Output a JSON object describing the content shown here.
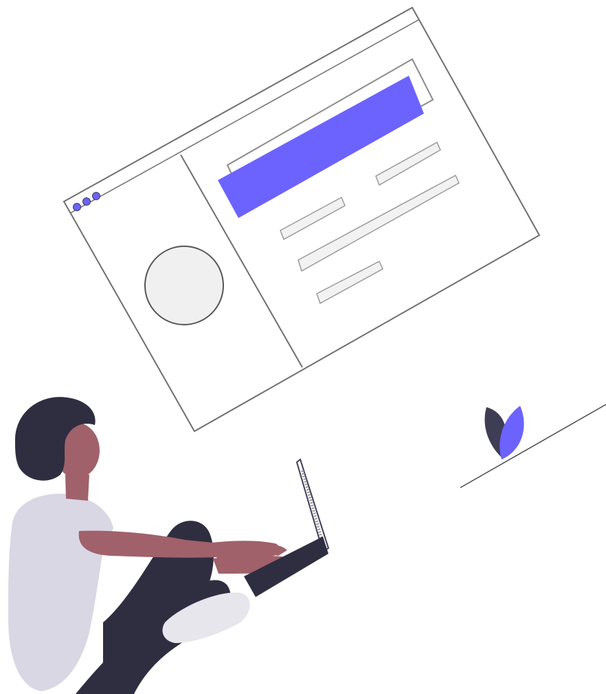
{
  "illustration": {
    "subject": "person-with-laptop-and-website-wireframe",
    "colors": {
      "accent": "#6c63ff",
      "accent_dark": "#5a52e8",
      "dark": "#2f2e41",
      "skin": "#a0616a",
      "shirt": "#d9d7e4",
      "shoe": "#e6e6ec",
      "outline": "#3f3d56",
      "frame": "#6e6e6e",
      "placeholder_fill": "#f2f2f2",
      "placeholder_stroke": "#9a9a9a",
      "background": "#ffffff"
    },
    "icons": [
      "browser-dot-icon",
      "browser-dot-icon",
      "browser-dot-icon",
      "leaf-icon"
    ],
    "text": []
  }
}
